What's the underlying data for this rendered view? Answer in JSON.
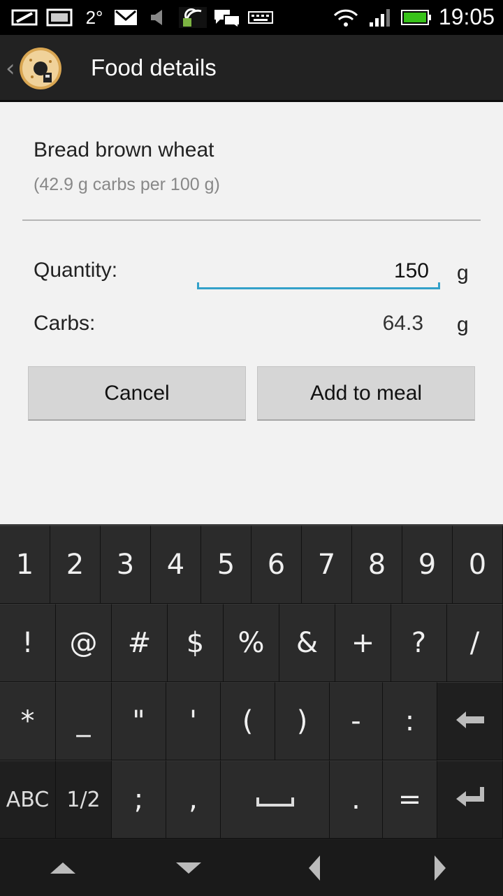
{
  "status_bar": {
    "temperature": "2°",
    "time": "19:05",
    "icons": [
      "screen-share-icon",
      "album-icon",
      "weather-temp",
      "gmail-icon",
      "mute-icon",
      "cast-icon",
      "chat-icon",
      "keyboard-icon",
      "wifi-icon",
      "signal-icon",
      "battery-icon"
    ]
  },
  "action_bar": {
    "title": "Food details",
    "logo": "donut-logo-icon"
  },
  "food": {
    "name": "Bread brown wheat",
    "info": "(42.9 g carbs per 100 g)"
  },
  "quantity": {
    "label": "Quantity:",
    "value": "150",
    "unit": "g"
  },
  "carbs": {
    "label": "Carbs:",
    "value": "64.3",
    "unit": "g"
  },
  "buttons": {
    "cancel": "Cancel",
    "add": "Add to meal"
  },
  "keyboard": {
    "row1": [
      "1",
      "2",
      "3",
      "4",
      "5",
      "6",
      "7",
      "8",
      "9",
      "0"
    ],
    "row2": [
      "!",
      "@",
      "#",
      "$",
      "%",
      "&",
      "+",
      "?",
      "/"
    ],
    "row3": [
      "*",
      "_",
      "\"",
      "'",
      "(",
      ")",
      "-",
      ":"
    ],
    "row4": [
      "ABC",
      "1/2",
      ";",
      ",",
      "",
      ".",
      "="
    ],
    "backspace": "backspace-icon",
    "enter": "enter-icon",
    "nav": [
      "up-arrow-icon",
      "down-arrow-icon",
      "left-arrow-icon",
      "right-arrow-icon"
    ]
  }
}
